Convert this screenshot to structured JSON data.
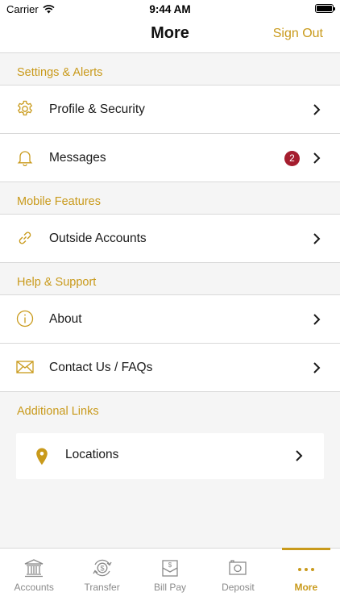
{
  "status_bar": {
    "carrier": "Carrier",
    "time": "9:44 AM"
  },
  "nav": {
    "title": "More",
    "sign_out": "Sign Out"
  },
  "sections": {
    "settings": {
      "header": "Settings & Alerts",
      "items": [
        {
          "label": "Profile & Security",
          "icon": "gear-icon"
        },
        {
          "label": "Messages",
          "icon": "bell-icon",
          "badge": "2"
        }
      ]
    },
    "mobile": {
      "header": "Mobile Features",
      "items": [
        {
          "label": "Outside Accounts",
          "icon": "link-icon"
        }
      ]
    },
    "help": {
      "header": "Help & Support",
      "items": [
        {
          "label": "About",
          "icon": "info-icon"
        },
        {
          "label": "Contact Us / FAQs",
          "icon": "envelope-icon"
        }
      ]
    },
    "links": {
      "header": "Additional Links",
      "items": [
        {
          "label": "Locations",
          "icon": "location-pin-icon"
        }
      ]
    }
  },
  "tabs": [
    {
      "label": "Accounts",
      "icon": "bank-icon"
    },
    {
      "label": "Transfer",
      "icon": "transfer-icon"
    },
    {
      "label": "Bill Pay",
      "icon": "bill-pay-icon"
    },
    {
      "label": "Deposit",
      "icon": "camera-icon"
    },
    {
      "label": "More",
      "icon": "more-dots-icon",
      "active": true
    }
  ],
  "colors": {
    "accent": "#c99a1b",
    "badge": "#a51d2e",
    "background": "#f5f5f5",
    "inactive_tab": "#8a8a8a"
  }
}
